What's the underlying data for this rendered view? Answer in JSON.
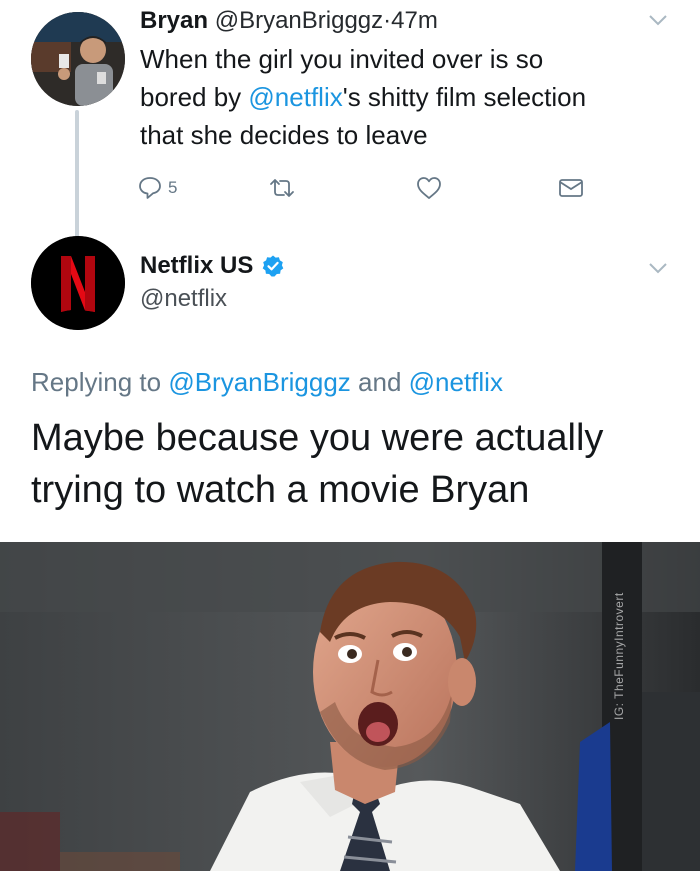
{
  "tweet1": {
    "name": "Bryan",
    "handle": "@BryanBrigggz",
    "dot": "·",
    "time": "47m",
    "text_lines": [
      "When the girl you invited over is so",
      "bored by ",
      "@netflix",
      "'s shitty film selection",
      "that she decides to leave"
    ],
    "reply_count": "5",
    "icons": {
      "reply": "reply-icon",
      "retweet": "retweet-icon",
      "like": "heart-icon",
      "dm": "envelope-icon",
      "menu": "chevron-down-icon"
    }
  },
  "tweet2": {
    "name": "Netflix US",
    "handle": "@netflix",
    "verified_icon": "verified-badge-icon",
    "replying_prefix": "Replying to ",
    "replying_user1": "@BryanBrigggz",
    "replying_and": " and ",
    "replying_user2": "@netflix",
    "text_line1": "Maybe because you were actually",
    "text_line2": "trying to watch a movie Bryan"
  },
  "image": {
    "watermark": "IG: TheFunnyIntrovert"
  },
  "colors": {
    "link": "#1b95e0",
    "netflix_red": "#e50914",
    "verified": "#1da1f2",
    "muted": "#657786"
  }
}
